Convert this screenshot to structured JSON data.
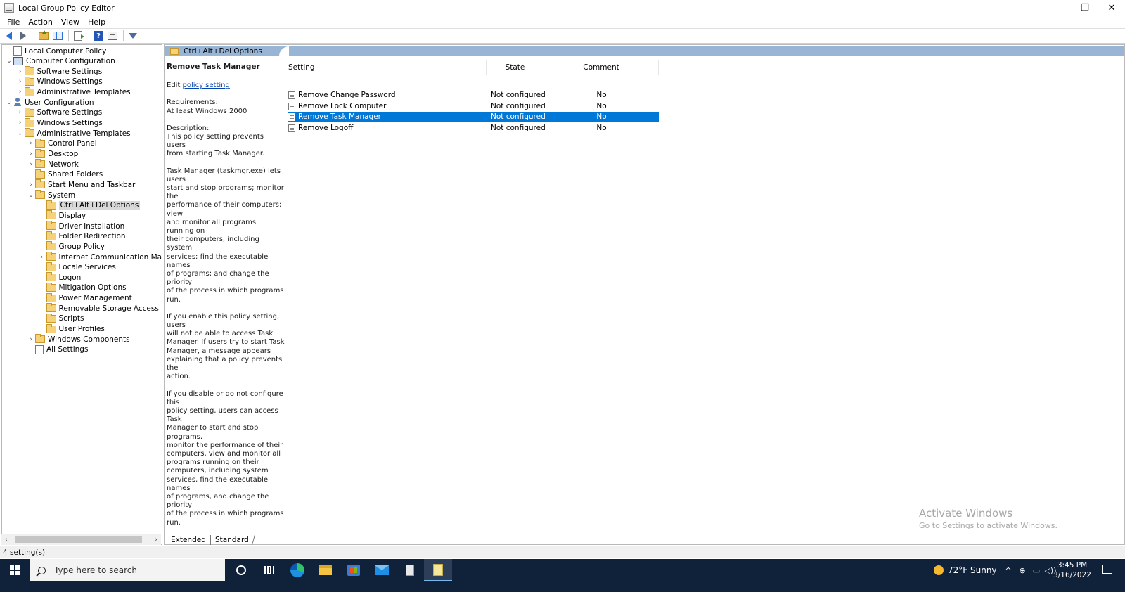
{
  "window": {
    "title": "Local Group Policy Editor",
    "controls": {
      "minimize": "—",
      "restore": "❐",
      "close": "✕"
    }
  },
  "menu": [
    "File",
    "Action",
    "View",
    "Help"
  ],
  "toolbar": {
    "icons": [
      "back-arrow-icon",
      "forward-arrow-icon",
      "up-folder-icon",
      "show-tree-icon",
      "export-list-icon",
      "help-icon",
      "properties-icon",
      "filter-icon"
    ],
    "help_glyph": "?"
  },
  "tree": {
    "expanders": {
      "expanded": "⌄",
      "collapsed": "›"
    },
    "items": [
      {
        "label": "Local Computer Policy",
        "level": 0,
        "expander": "none",
        "icon": "doc"
      },
      {
        "label": "Computer Configuration",
        "level": 0,
        "expander": "expanded",
        "icon": "pc"
      },
      {
        "label": "Software Settings",
        "level": 1,
        "expander": "collapsed",
        "icon": "folder"
      },
      {
        "label": "Windows Settings",
        "level": 1,
        "expander": "collapsed",
        "icon": "folder"
      },
      {
        "label": "Administrative Templates",
        "level": 1,
        "expander": "collapsed",
        "icon": "folder"
      },
      {
        "label": "User Configuration",
        "level": 0,
        "expander": "expanded",
        "icon": "user"
      },
      {
        "label": "Software Settings",
        "level": 1,
        "expander": "collapsed",
        "icon": "folder"
      },
      {
        "label": "Windows Settings",
        "level": 1,
        "expander": "collapsed",
        "icon": "folder"
      },
      {
        "label": "Administrative Templates",
        "level": 1,
        "expander": "expanded",
        "icon": "folder"
      },
      {
        "label": "Control Panel",
        "level": 2,
        "expander": "collapsed",
        "icon": "folder"
      },
      {
        "label": "Desktop",
        "level": 2,
        "expander": "collapsed",
        "icon": "folder"
      },
      {
        "label": "Network",
        "level": 2,
        "expander": "collapsed",
        "icon": "folder"
      },
      {
        "label": "Shared Folders",
        "level": 2,
        "expander": "none",
        "icon": "folder"
      },
      {
        "label": "Start Menu and Taskbar",
        "level": 2,
        "expander": "collapsed",
        "icon": "folder"
      },
      {
        "label": "System",
        "level": 2,
        "expander": "expanded",
        "icon": "folder"
      },
      {
        "label": "Ctrl+Alt+Del Options",
        "level": 3,
        "expander": "none",
        "icon": "folder",
        "selected": true
      },
      {
        "label": "Display",
        "level": 3,
        "expander": "none",
        "icon": "folder"
      },
      {
        "label": "Driver Installation",
        "level": 3,
        "expander": "none",
        "icon": "folder"
      },
      {
        "label": "Folder Redirection",
        "level": 3,
        "expander": "none",
        "icon": "folder"
      },
      {
        "label": "Group Policy",
        "level": 3,
        "expander": "none",
        "icon": "folder"
      },
      {
        "label": "Internet Communication Manage",
        "level": 3,
        "expander": "collapsed",
        "icon": "folder"
      },
      {
        "label": "Locale Services",
        "level": 3,
        "expander": "none",
        "icon": "folder"
      },
      {
        "label": "Logon",
        "level": 3,
        "expander": "none",
        "icon": "folder"
      },
      {
        "label": "Mitigation Options",
        "level": 3,
        "expander": "none",
        "icon": "folder"
      },
      {
        "label": "Power Management",
        "level": 3,
        "expander": "none",
        "icon": "folder"
      },
      {
        "label": "Removable Storage Access",
        "level": 3,
        "expander": "none",
        "icon": "folder"
      },
      {
        "label": "Scripts",
        "level": 3,
        "expander": "none",
        "icon": "folder"
      },
      {
        "label": "User Profiles",
        "level": 3,
        "expander": "none",
        "icon": "folder"
      },
      {
        "label": "Windows Components",
        "level": 2,
        "expander": "collapsed",
        "icon": "folder"
      },
      {
        "label": "All Settings",
        "level": 2,
        "expander": "none",
        "icon": "doc"
      }
    ],
    "scroll": {
      "left": "‹",
      "right": "›"
    }
  },
  "right_pane": {
    "header_title": "Ctrl+Alt+Del Options",
    "description": {
      "title": "Remove Task Manager",
      "edit_prefix": "Edit ",
      "edit_link": "policy setting ",
      "requirements_label": "Requirements:",
      "requirements_value": "At least Windows 2000",
      "description_label": "Description:",
      "para1": "This policy setting prevents users\nfrom starting Task Manager.",
      "para2": "Task Manager (taskmgr.exe) lets users\nstart and stop programs; monitor the\nperformance of their computers; view\nand monitor all programs running on\ntheir computers, including system\nservices; find the executable names\nof programs; and change the priority\nof the process in which programs run.",
      "para3": "If you enable this policy setting, users\nwill not be able to access Task\nManager. If users try to start Task\nManager, a message appears\nexplaining that a policy prevents the\naction.",
      "para4": "If you disable or do not configure this\npolicy setting, users can access Task\nManager to  start and stop programs,\nmonitor the performance of their\ncomputers, view and monitor all\nprograms running on their\ncomputers, including system\nservices, find the executable names\nof programs, and change the priority\nof the process in which programs run."
    },
    "columns": [
      "Setting",
      "State",
      "Comment"
    ],
    "rows": [
      {
        "setting": "Remove Change Password",
        "state": "Not configured",
        "comment": "No"
      },
      {
        "setting": "Remove Lock Computer",
        "state": "Not configured",
        "comment": "No"
      },
      {
        "setting": "Remove Task Manager",
        "state": "Not configured",
        "comment": "No",
        "selected": true
      },
      {
        "setting": "Remove Logoff",
        "state": "Not configured",
        "comment": "No"
      }
    ],
    "tabs": [
      "Extended",
      "Standard"
    ]
  },
  "watermark": {
    "line1": "Activate Windows",
    "line2": "Go to Settings to activate Windows."
  },
  "status_bar": {
    "text": "4 setting(s)"
  },
  "taskbar": {
    "search_placeholder": "Type here to search",
    "apps": [
      "cortana-icon",
      "task-view-icon",
      "edge-icon",
      "file-explorer-icon",
      "store-icon",
      "mail-icon",
      "group-policy-icon",
      "notepad-icon"
    ],
    "weather": "72°F  Sunny",
    "tray_glyphs": [
      "^",
      "⊕",
      "▭",
      "◁))"
    ],
    "time": "3:45 PM",
    "date": "3/16/2022"
  },
  "colors": {
    "selection": "#0078d7",
    "header_band": "#98b5d6",
    "taskbar": "#10213a"
  }
}
